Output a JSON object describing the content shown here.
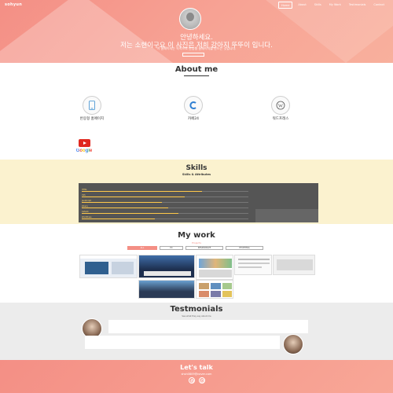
{
  "header": {
    "logo": "sohyun",
    "nav": [
      "Home",
      "About",
      "Skills",
      "My Work",
      "Testimonials",
      "Contact"
    ]
  },
  "hero": {
    "greeting_line1": "안녕하세요.",
    "greeting_line2": "저는 소현이구요 이 사진은 저희 강아지 뚜뚜이 입니다.",
    "subtitle": "이 홈페이지는 독학으로 반응형 홈페이지를 만드는 것입니다."
  },
  "about": {
    "title": "About me",
    "features": [
      {
        "icon": "mobile-icon",
        "title": "반응형 홈페이지"
      },
      {
        "icon": "c-icon",
        "title": "카페24"
      },
      {
        "icon": "wordpress-icon",
        "title": "워드프레스"
      }
    ],
    "links": [
      {
        "icon": "youtube-icon"
      },
      {
        "icon": "google-icon",
        "label": "Google"
      }
    ]
  },
  "skills": {
    "title": "Skills",
    "subtitle": "Skills & Attributes",
    "bars": [
      {
        "label": "HTML",
        "value": 0.72
      },
      {
        "label": "CSS",
        "value": 0.62
      },
      {
        "label": "JavaScript",
        "value": 0.48
      },
      {
        "label": "jQuery",
        "value": 0.52
      },
      {
        "label": "Cafe24",
        "value": 0.58
      },
      {
        "label": "WordPress",
        "value": 0.44
      }
    ]
  },
  "work": {
    "title": "My work",
    "subtitle": "Projects",
    "filters": [
      "ALL",
      "PC",
      "RESPONSIVE",
      "ETCETERA"
    ]
  },
  "testimonials": {
    "title": "Testmonials",
    "subtitle": "See what they say about me"
  },
  "footer": {
    "title": "Let's talk",
    "email": "shsh0809@naver.com"
  },
  "colors": {
    "accent": "#f48f85",
    "skills_bg": "#fbf2cf",
    "skill_bar": "#ffc94a",
    "testi_bg": "#ececec"
  }
}
